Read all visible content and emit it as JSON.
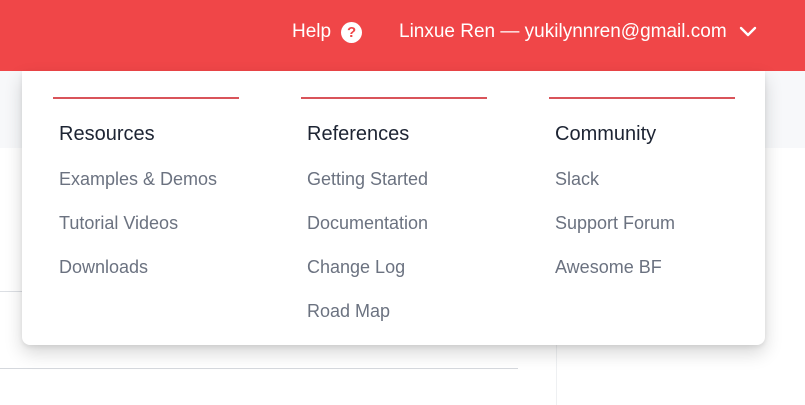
{
  "topbar": {
    "help_label": "Help",
    "help_icon": "?",
    "user_label": "Linxue Ren — yukilynnren@gmail.com",
    "colors": {
      "background": "#f04648",
      "text": "#ffffff"
    }
  },
  "dropdown": {
    "columns": [
      {
        "heading": "Resources",
        "links": [
          "Examples & Demos",
          "Tutorial Videos",
          "Downloads"
        ]
      },
      {
        "heading": "References",
        "links": [
          "Getting Started",
          "Documentation",
          "Change Log",
          "Road Map"
        ]
      },
      {
        "heading": "Community",
        "links": [
          "Slack",
          "Support Forum",
          "Awesome BF"
        ]
      }
    ],
    "colors": {
      "rule": "#d9545a",
      "heading": "#1d2433",
      "link": "#6b7280"
    }
  }
}
